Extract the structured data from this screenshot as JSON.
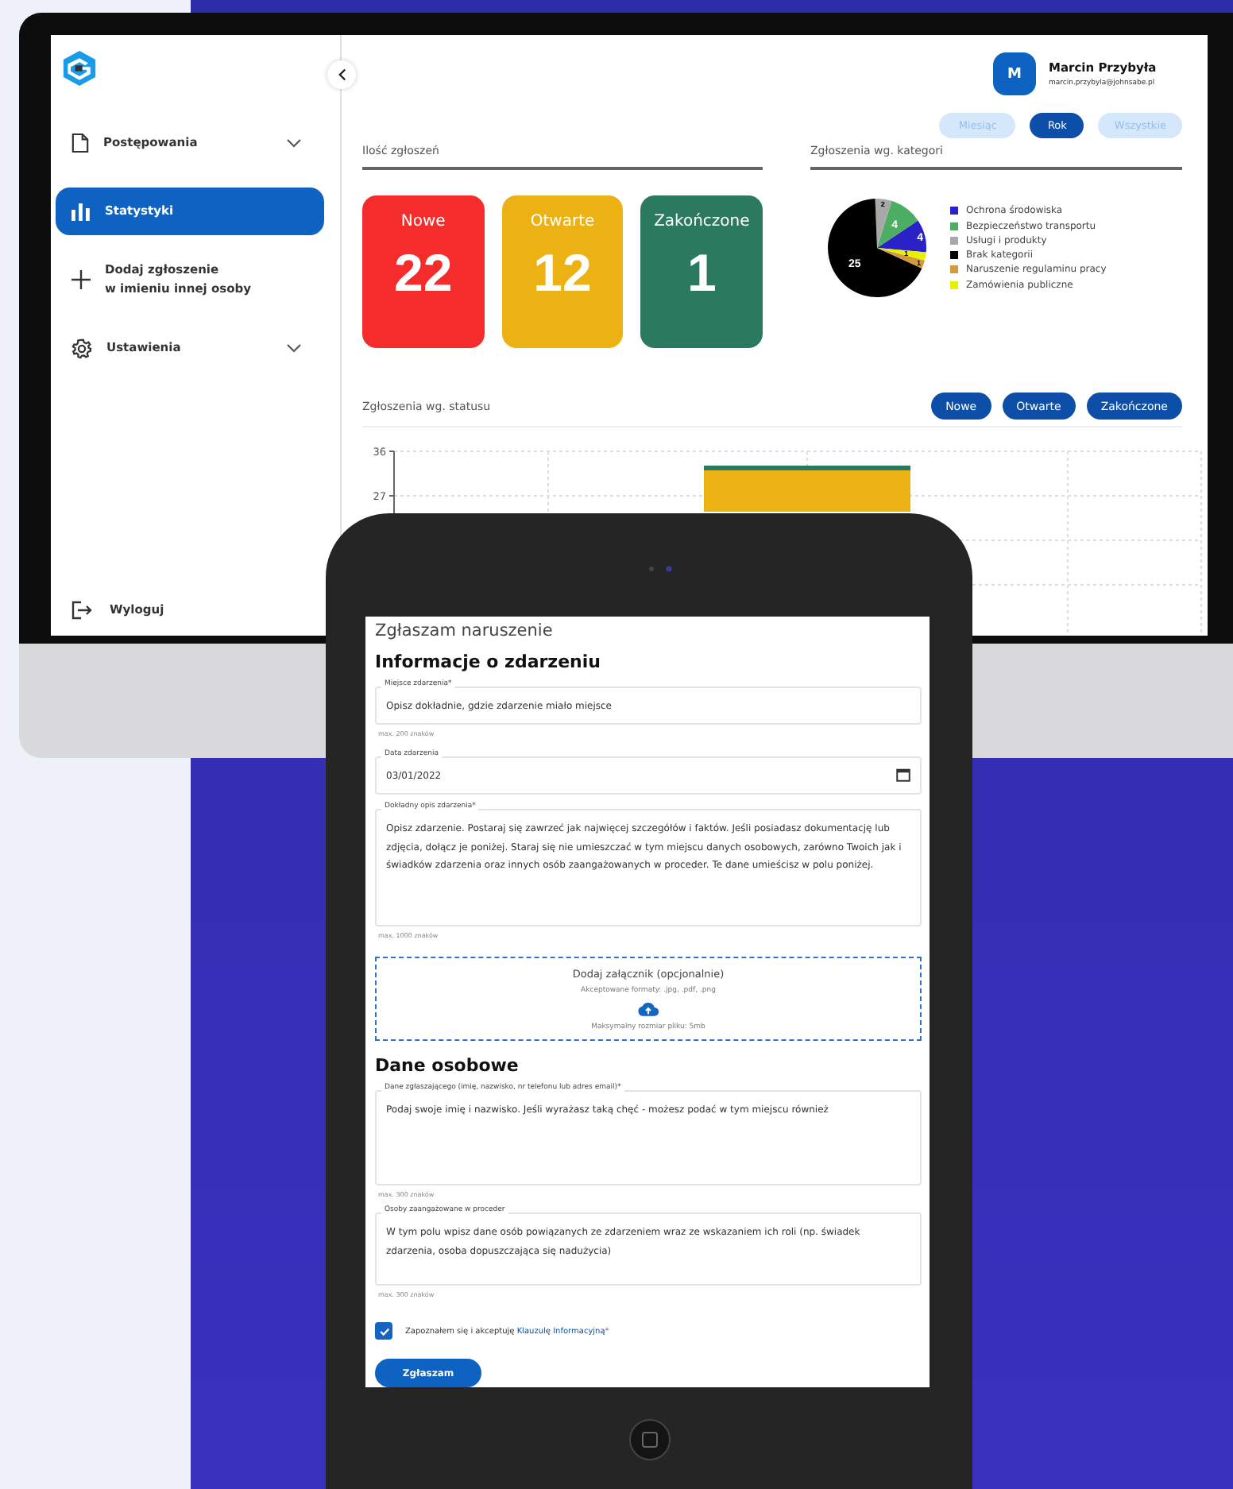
{
  "monitor": {
    "sidebar": {
      "items": [
        {
          "label": "Postępowania",
          "submenu": true,
          "selected": false
        },
        {
          "label": "Statystyki",
          "submenu": false,
          "selected": true
        },
        {
          "label": "Dodaj zgłoszenie\nw imieniu innej osoby",
          "submenu": false,
          "selected": false
        },
        {
          "label": "Ustawienia",
          "submenu": true,
          "selected": false
        }
      ],
      "logout": "Wyloguj"
    },
    "user": {
      "initial": "M",
      "name": "Marcin Przybyła",
      "email": "marcin.przybyla@johnsabe.pl"
    },
    "periods": [
      {
        "label": "Miesiąc",
        "selected": false
      },
      {
        "label": "Rok",
        "selected": true
      },
      {
        "label": "Wszystkie",
        "selected": false
      }
    ],
    "counts": {
      "title": "Ilość zgłoszeń",
      "cards": [
        {
          "label": "Nowe",
          "value": "22",
          "color": "#f42c2c"
        },
        {
          "label": "Otwarte",
          "value": "12",
          "color": "#ecb214"
        },
        {
          "label": "Zakończone",
          "value": "1",
          "color": "#2b7a5f"
        }
      ]
    },
    "categories": {
      "title": "Zgłoszenia wg. kategori",
      "chart_data": {
        "type": "pie",
        "categories": [
          "Ochrona środowiska",
          "Bezpieczeństwo transportu",
          "Usługi i produkty",
          "Brak kategorii",
          "Naruszenie regulaminu pracy",
          "Zamówienia publiczne"
        ],
        "values": [
          4,
          4,
          2,
          25,
          1,
          1
        ],
        "colors": [
          "#2a22c8",
          "#4cae62",
          "#a8a8a8",
          "#000000",
          "#d29a3c",
          "#e6f200"
        ],
        "data_labels": true,
        "legend": "right"
      }
    },
    "status": {
      "title": "Zgłoszenia wg. statusu",
      "filters": [
        {
          "label": "Nowe",
          "selected": true
        },
        {
          "label": "Otwarte",
          "selected": true
        },
        {
          "label": "Zakończone",
          "selected": true
        }
      ],
      "axis_ticks": [
        "36",
        "27"
      ]
    }
  },
  "tablet": {
    "form": {
      "title": "Zgłaszam naruszenie",
      "section_1": "Informacje o zdarzeniu",
      "place": {
        "label": "Miejsce zdarzenia*",
        "placeholder": "Opisz dokładnie, gdzie zdarzenie miało miejsce",
        "helper": "max. 200 znaków"
      },
      "date": {
        "label": "Data zdarzenia",
        "value": "03/01/2022"
      },
      "description": {
        "label": "Dokładny opis zdarzenia*",
        "placeholder": "Opisz zdarzenie. Postaraj się zawrzeć jak najwięcej szczegółów i faktów. Jeśli posiadasz dokumentację lub zdjęcia, dołącz je poniżej. Staraj się nie umieszczać w tym miejscu danych osobowych, zarówno Twoich jak i świadków zdarzenia oraz innych osób zaangażowanych w proceder. Te dane umieścisz w polu poniżej.",
        "helper": "max. 1000 znaków"
      },
      "attachment": {
        "title": "Dodaj załącznik (opcjonalnie)",
        "formats": "Akceptowane formaty: .jpg, .pdf, .png",
        "max_size": "Maksymalny rozmiar pliku: 5mb"
      },
      "section_2": "Dane osobowe",
      "reporter": {
        "label": "Dane zgłaszającego (imię, nazwisko, nr telefonu lub adres email)*",
        "placeholder": "Podaj swoje imię i nazwisko. Jeśli wyrażasz taką chęć - możesz podać w tym miejscu również",
        "helper": "max. 300 znaków"
      },
      "involved": {
        "label": "Osoby zaangażowane w proceder",
        "placeholder": "W tym polu wpisz dane osób powiązanych ze zdarzeniem wraz ze wskazaniem ich roli (np. świadek zdarzenia, osoba dopuszczająca się nadużycia)",
        "helper": "max. 300 znaków"
      },
      "consent": {
        "text": "Zapoznałem się i akceptuję",
        "link": "Klauzulę Informacyjną",
        "required_mark": "*",
        "checked": true
      },
      "submit": "Zgłaszam"
    }
  }
}
